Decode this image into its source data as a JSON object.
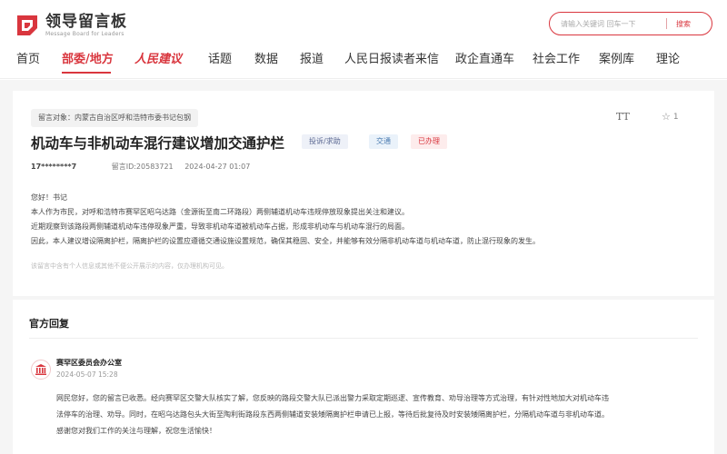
{
  "header": {
    "logo_title": "领导留言板",
    "logo_sub": "Message Board for Leaders",
    "search_placeholder": "请输入关键词 回车一下",
    "search_button": "搜索"
  },
  "nav": {
    "items": [
      "首页",
      "部委/地方",
      "人民建议",
      "话题",
      "数据",
      "报道",
      "人民日报读者来信",
      "政企直通车",
      "社会工作",
      "案例库",
      "理论"
    ]
  },
  "message": {
    "target": "留言对象：内蒙古自治区呼和浩特市委书记包钢",
    "title": "机动车与非机动车混行建议增加交通护栏",
    "tags": {
      "category": "投诉/求助",
      "topic": "交通",
      "status": "已办理"
    },
    "font_icon_label": "TT",
    "star_count": "1",
    "user": "17********7",
    "message_id": "留言ID:20583721",
    "date": "2024-04-27 01:07",
    "body": [
      "您好！书记",
      "本人作为市民，对呼和浩特市赛罕区昭乌达路（金源街至南二环路段）两侧辅道机动车违规停放现象提出关注和建议。",
      "近期观察到该路段两侧辅道机动车违停现象严重，导致非机动车道被机动车占据，形成非机动车与机动车混行的局面。",
      "因此，本人建议增设隔离护栏，隔离护栏的设置应遵循交通设施设置规范，确保其稳固、安全，并能够有效分隔非机动车道与机动车道，防止混行现象的发生。"
    ],
    "privacy_note": "该留言中含有个人信息或其他不便公开展示的内容，仅办理机构可见。"
  },
  "reply": {
    "heading": "官方回复",
    "department": "赛罕区委员会办公室",
    "date": "2024-05-07 15:28",
    "body": [
      "网民您好，您的留言已收悉。经向赛罕区交警大队核实了解，您反映的路段交警大队已派出警力采取定期巡逻、宣传教育、劝导治理等方式治理，有针对性地加大对机动车违",
      "法停车的治理、劝导。同时，在昭乌达路包头大街至陶利街路段东西两侧辅道安装矮隔离护栏申请已上报，等待后批复待及时安装矮隔离护栏，分隔机动车道与非机动车道。",
      "感谢您对我们工作的关注与理解，祝您生活愉快！"
    ]
  },
  "colors": {
    "accent": "#d9363e"
  }
}
